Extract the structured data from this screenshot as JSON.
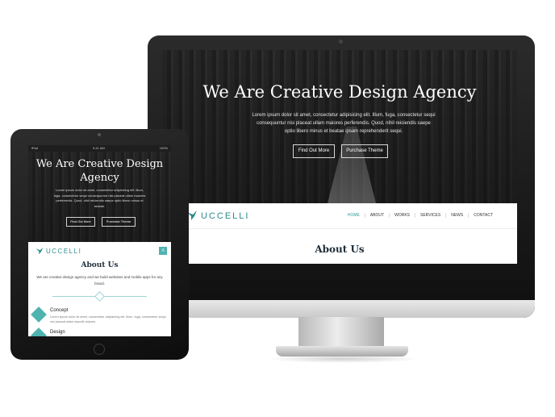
{
  "colors": {
    "accent": "#2a9d9b",
    "title_dark": "#1e2d3a",
    "device_frame": "#111111"
  },
  "desktop": {
    "hero": {
      "title": "We Are Creative Design Agency",
      "lead": "Lorem ipsum dolor sit amet, consectetur adipisicing elit. Illum, fuga, consectetur sequi consequuntur nisi placeat ullam maiores perferendis. Quod, nihil reiciendis saepe optio libero minus et beatae ipsam reprehenderit sequi.",
      "primary_button": "Find Out More",
      "secondary_button": "Purchase Theme"
    },
    "nav": {
      "logo": "UCCELLI",
      "items": [
        "HOME",
        "ABOUT",
        "WORKS",
        "SERVICES",
        "NEWS",
        "CONTACT"
      ]
    },
    "about_title": "About Us"
  },
  "tablet": {
    "status": {
      "left": "iPad",
      "center": "9:41 AM",
      "right": "100%"
    },
    "hero": {
      "title": "We Are Creative Design Agency",
      "lead": "Lorem ipsum dolor sit amet, consectetur adipisicing elit. Illum, fuga, consectetur sequi consequuntur nisi placeat ullam maiores perferendis. Quod, nihil reiciendis saepe optio libero minus et beatae.",
      "primary_button": "Find Out More",
      "secondary_button": "Purchase Theme"
    },
    "nav": {
      "logo": "UCCELLI",
      "menu_icon": "menu-icon"
    },
    "about_title": "About Us",
    "about_text": "We are creative design agency and we build websites and mobile apps for any brand.",
    "features": [
      {
        "title": "Concept",
        "icon": "heart-icon",
        "text": "Lorem ipsum dolor sit amet, consectetur adipisicing elit. Illum, fuga, consectetur sequi nisi placeat ullam impedit dolores."
      },
      {
        "title": "Design",
        "icon": "pen-icon",
        "text": ""
      }
    ]
  }
}
